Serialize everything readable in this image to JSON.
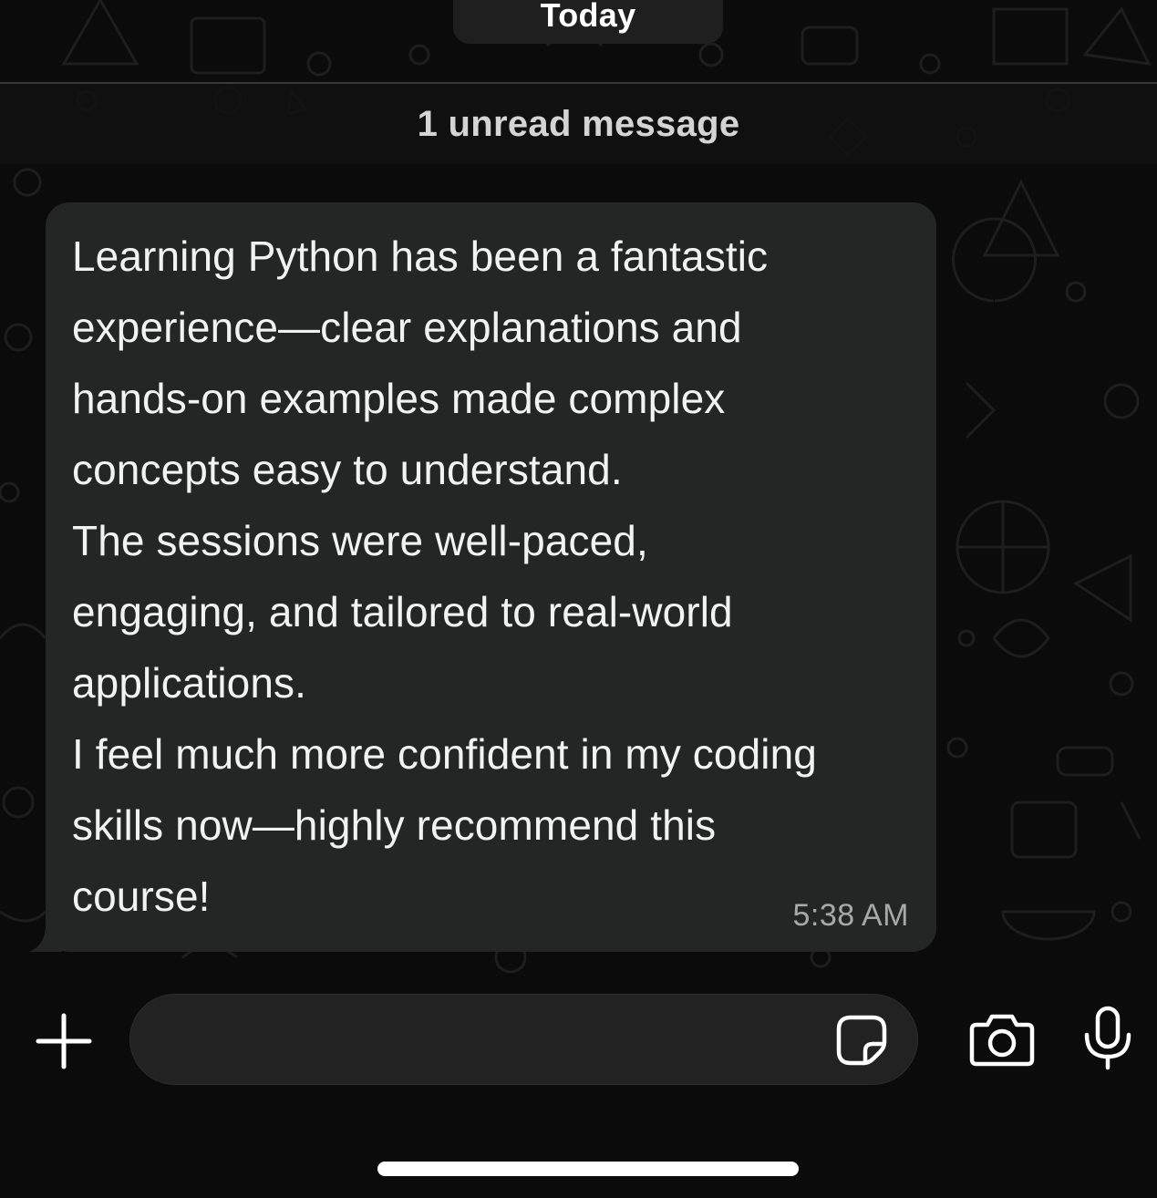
{
  "chat": {
    "date_label": "Today",
    "unread_label": "1 unread message",
    "message": {
      "lines": [
        "Learning Python has been a fantastic",
        "experience—clear explanations and",
        "hands-on examples made complex",
        "concepts easy to understand.",
        "The sessions were well-paced,",
        "engaging, and tailored to real-world",
        "applications.",
        "I feel much more confident in my coding",
        "skills now—highly recommend this",
        "course!"
      ],
      "time": "5:38 AM"
    }
  },
  "composer": {
    "message_value": "",
    "icons": {
      "attach": "plus-icon",
      "sticker": "sticker-icon",
      "camera": "camera-icon",
      "voice": "microphone-icon"
    }
  },
  "colors": {
    "background": "#0b0b0b",
    "bubble": "#242626",
    "text": "#f2f2f2",
    "timestamp": "#a8a8a8",
    "field": "#222222"
  }
}
